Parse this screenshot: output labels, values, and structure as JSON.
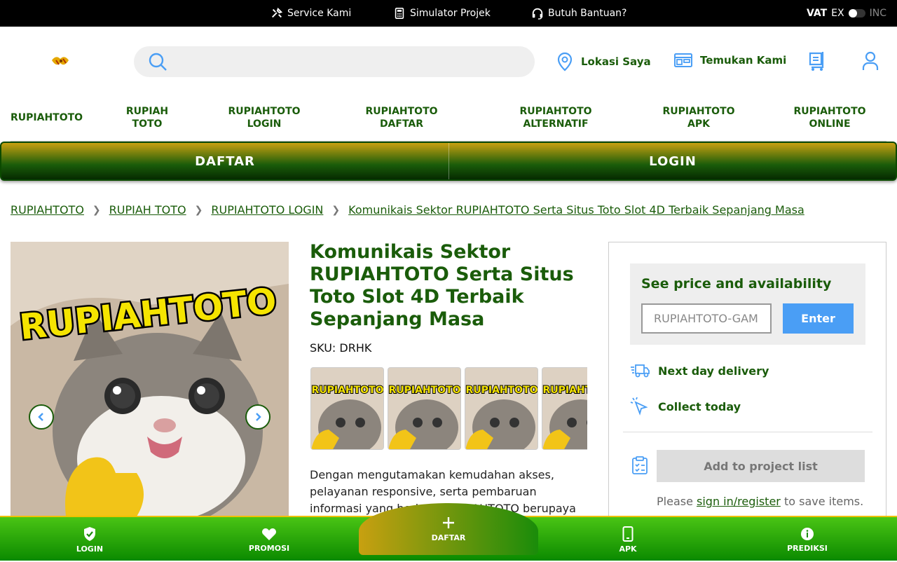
{
  "topbar": {
    "service": "Service Kami",
    "simulator": "Simulator Projek",
    "help": "Butuh Bantuan?",
    "vat_label": "VAT",
    "vat_ex": "EX",
    "vat_inc": "INC"
  },
  "header": {
    "location": "Lokasi Saya",
    "find_us": "Temukan Kami"
  },
  "nav": [
    "RUPIAHTOTO",
    "RUPIAH TOTO",
    "RUPIAHTOTO LOGIN",
    "RUPIAHTOTO DAFTAR",
    "RUPIAHTOTO ALTERNATIF",
    "RUPIAHTOTO APK",
    "RUPIAHTOTO ONLINE"
  ],
  "auth": {
    "register": "DAFTAR",
    "login": "LOGIN"
  },
  "breadcrumbs": [
    "RUPIAHTOTO",
    "RUPIAH TOTO",
    "RUPIAHTOTO LOGIN",
    "Komunikais Sektor RUPIAHTOTO Serta Situs Toto Slot 4D Terbaik Sepanjang Masa"
  ],
  "product": {
    "title": "Komunikais Sektor RUPIAHTOTO Serta Situs Toto Slot 4D Terbaik Sepanjang Masa",
    "sku": "SKU: DRHK",
    "image_text": "RUPIAHTOTO",
    "description": "Dengan mengutamakan kemudahan akses, pelayanan responsive, serta pembaruan informasi yang berkala, RUPIAHTOTO berupaya"
  },
  "panel": {
    "avail_title": "See price and availability",
    "postcode_value": "RUPIAHTOTO-GAM",
    "enter": "Enter",
    "next_day": "Next day delivery",
    "collect": "Collect today",
    "add_project": "Add to project list",
    "please": "Please",
    "signin": "sign in/register",
    "save_items": "to save items."
  },
  "bottom": {
    "login": "LOGIN",
    "promo": "PROMOSI",
    "register": "DAFTAR",
    "apk": "APK",
    "predict": "PREDIKSI"
  },
  "colors": {
    "brand_green": "#1a5c0a",
    "accent_blue": "#4a9ef5",
    "gold": "#c8a010"
  }
}
